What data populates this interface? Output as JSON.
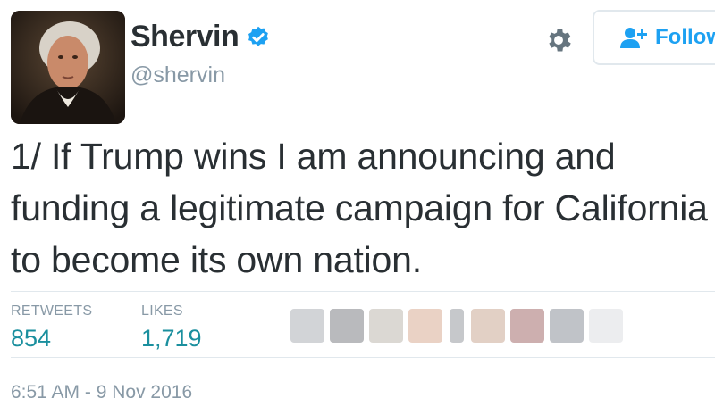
{
  "user": {
    "display_name": "Shervin",
    "handle": "@shervin",
    "verified_icon": "verified-badge-icon",
    "avatar_icon": "profile-portrait"
  },
  "actions": {
    "settings_icon": "gear-icon",
    "follow_label": "Follow",
    "follow_icon": "add-user-icon"
  },
  "tweet": {
    "text": "1/ If Trump wins I am announcing and funding a legitimate campaign for California to become its own nation."
  },
  "stats": {
    "retweets_label": "RETWEETS",
    "retweets_count": "854",
    "likes_label": "LIKES",
    "likes_count": "1,719"
  },
  "timestamp": "6:51 AM - 9 Nov 2016",
  "colors": {
    "accent": "#1da1f2",
    "count": "#1a8f9e",
    "muted": "#8899a6",
    "text": "#292f33",
    "divider": "#e1e8ed"
  }
}
